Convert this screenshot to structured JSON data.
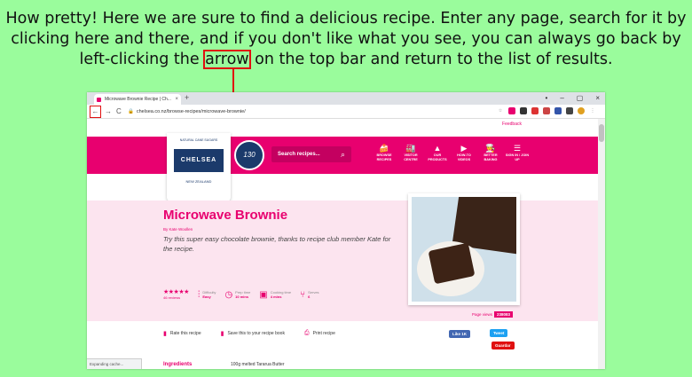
{
  "caption": {
    "before": "How pretty! Here we are sure to find a delicious recipe. Enter any page, search for it by clicking here and there, and if you don't like what you see, you can always go back by left-clicking the ",
    "highlight": "arrow",
    "after": " on the top bar and return to the list of results."
  },
  "browser": {
    "tab_title": "Microwave Brownie Recipe | Ch...",
    "tab_close": "×",
    "new_tab": "+",
    "window_controls": [
      "•",
      "–",
      "▢",
      "×"
    ],
    "back": "←",
    "forward": "→",
    "reload": "C",
    "url": "chelsea.co.nz/browse-recipes/microwave-brownie/",
    "status": "Expanding cache..."
  },
  "site": {
    "feedback": "Feedback",
    "logo": {
      "top": "NATURAL CANE SUGARS",
      "brand": "CHELSEA",
      "bottom": "NEW ZEALAND"
    },
    "seal": "130",
    "search_placeholder": "Search recipes...",
    "nav": [
      {
        "icon": "🍰",
        "label": "BROWSE RECIPES"
      },
      {
        "icon": "🏭",
        "label": "VISITOR CENTRE"
      },
      {
        "icon": "▲",
        "label": "OUR PRODUCTS"
      },
      {
        "icon": "▶",
        "label": "HOW-TO VIDEOS"
      },
      {
        "icon": "👨‍🍳",
        "label": "BETTER BAKING"
      },
      {
        "icon": "☰",
        "label": "SIGN IN / JOIN UP"
      }
    ]
  },
  "recipe": {
    "title": "Microwave Brownie",
    "byline": "By Kate Woollen",
    "description": "Try this super easy chocolate brownie, thanks to recipe club member Kate for the recipe.",
    "rating_stars": "★★★★★",
    "reviews": "46 reviews",
    "difficulty_label": "Difficulty",
    "difficulty": "Easy",
    "prep_label": "Prep time",
    "prep": "10 mins",
    "cook_label": "Cooking time",
    "cook": "4 mins",
    "serves_label": "Serves",
    "serves": "6",
    "page_views_label": "Page views",
    "page_views": "238083"
  },
  "actions": {
    "rate": "Rate this recipe",
    "save": "Save this to your recipe book",
    "print": "Print recipe",
    "facebook": "Like 1K",
    "tweet": "Tweet",
    "guardian": "Guardar"
  },
  "ingredients": {
    "heading": "Ingredients",
    "first": "100g melted Tararua Butter"
  }
}
